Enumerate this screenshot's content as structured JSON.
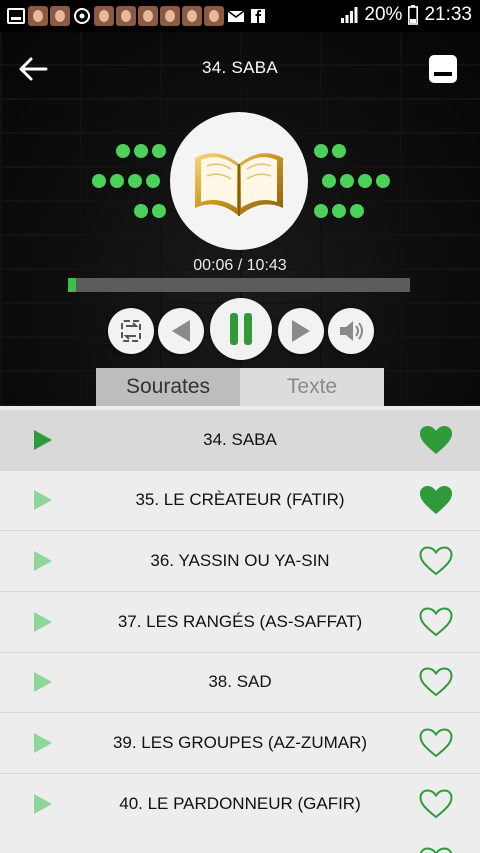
{
  "status_bar": {
    "battery": "20%",
    "time": "21:33"
  },
  "header": {
    "title": "34. SABA"
  },
  "player": {
    "time_display": "00:06 / 10:43",
    "progress": 0.01
  },
  "tabs": [
    {
      "label": "Sourates",
      "active": true
    },
    {
      "label": "Texte",
      "active": false
    }
  ],
  "colors": {
    "accent_green": "#3cbf4a",
    "dot_green": "#4cd15a"
  },
  "surahs": [
    {
      "label": "34. SABA",
      "favorite": true,
      "selected": true
    },
    {
      "label": "35. LE CRÈATEUR (FATIR)",
      "favorite": true,
      "selected": false
    },
    {
      "label": "36. YASSIN OU YA-SIN",
      "favorite": false,
      "selected": false
    },
    {
      "label": "37. LES RANGÉS (AS-SAFFAT)",
      "favorite": false,
      "selected": false
    },
    {
      "label": "38. SAD",
      "favorite": false,
      "selected": false
    },
    {
      "label": "39. LES GROUPES (AZ-ZUMAR)",
      "favorite": false,
      "selected": false
    },
    {
      "label": "40. LE PARDONNEUR (GAFIR)",
      "favorite": false,
      "selected": false
    }
  ]
}
